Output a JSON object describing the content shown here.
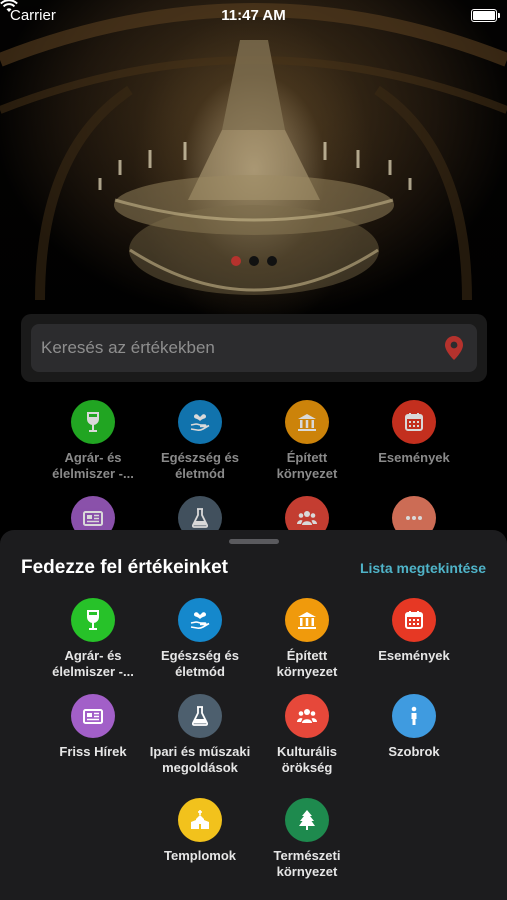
{
  "status": {
    "carrier": "Carrier",
    "time": "11:47 AM"
  },
  "hero": {
    "slides": 3,
    "active_slide": 1
  },
  "search": {
    "placeholder": "Keresés az értékekben"
  },
  "sheet": {
    "title": "Fedezze fel értékeinket",
    "link": "Lista megtekintése"
  },
  "categories": [
    {
      "label": "Agrár- és\nélelmiszer -...",
      "icon": "wine-glass-icon",
      "color": "#27c229"
    },
    {
      "label": "Egészség és\néletmód",
      "icon": "heart-hand-icon",
      "color": "#1588cc"
    },
    {
      "label": "Épített\nkörnyezet",
      "icon": "building-columns-icon",
      "color": "#f09a0c"
    },
    {
      "label": "Események",
      "icon": "calendar-icon",
      "color": "#e63824"
    },
    {
      "label": "Friss Hírek",
      "icon": "newspaper-icon",
      "color": "#a25fc8"
    },
    {
      "label": "Ipari és műszaki\nmegoldások",
      "icon": "flask-icon",
      "color": "#4d5f6e"
    },
    {
      "label": "Kulturális\nörökség",
      "icon": "people-group-icon",
      "color": "#e6483a"
    },
    {
      "label": "Szobrok",
      "icon": "statue-person-icon",
      "color": "#3f9be0"
    },
    {
      "label": "Templomok",
      "icon": "church-icon",
      "color": "#f2c21c"
    },
    {
      "label": "Természeti\nkörnyezet",
      "icon": "tree-icon",
      "color": "#1e8a4e"
    }
  ],
  "background_categories": [
    {
      "label": "Agrár- és\nélelmiszer -...",
      "icon": "wine-glass-icon",
      "color": "#27c229"
    },
    {
      "label": "Egészség és\néletmód",
      "icon": "heart-hand-icon",
      "color": "#1588cc"
    },
    {
      "label": "Épített\nkörnyezet",
      "icon": "building-columns-icon",
      "color": "#f09a0c"
    },
    {
      "label": "Események",
      "icon": "calendar-icon",
      "color": "#e63824"
    },
    {
      "label": "",
      "icon": "newspaper-icon",
      "color": "#a25fc8"
    },
    {
      "label": "",
      "icon": "flask-icon",
      "color": "#4d5f6e"
    },
    {
      "label": "",
      "icon": "people-group-icon",
      "color": "#e6483a"
    },
    {
      "label": "",
      "icon": "more-dots-icon",
      "color": "#f07f64"
    }
  ]
}
